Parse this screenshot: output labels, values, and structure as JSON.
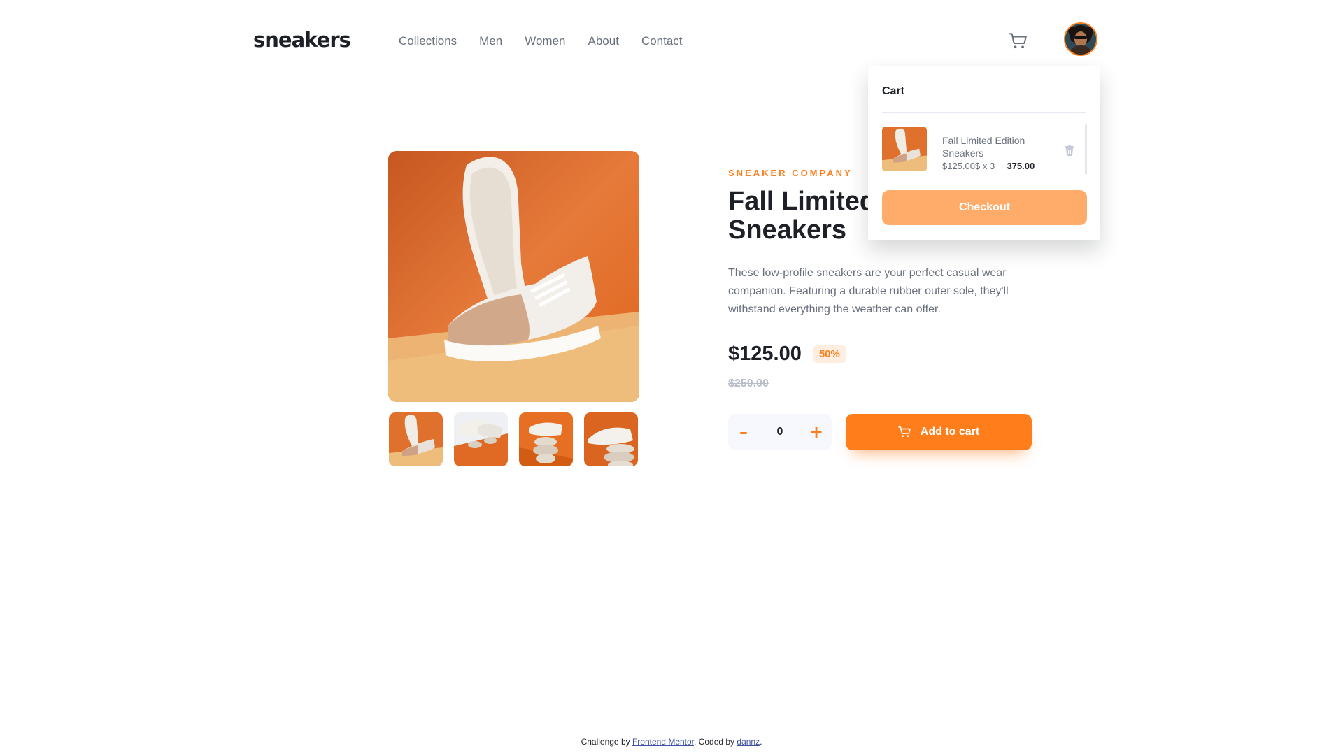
{
  "header": {
    "logo": "sneakers",
    "nav": [
      "Collections",
      "Men",
      "Women",
      "About",
      "Contact"
    ],
    "cart_icon": "cart-icon",
    "avatar_icon": "avatar"
  },
  "product": {
    "company": "SNEAKER COMPANY",
    "title": "Fall Limited Edition Sneakers",
    "description": "These low-profile sneakers are your perfect casual wear companion. Featuring a durable rubber outer sole, they'll withstand everything the weather can offer.",
    "price": "$125.00",
    "discount": "50%",
    "original_price": "$250.00",
    "quantity": "0",
    "minus_label": "–",
    "plus_label": "+",
    "add_to_cart_label": "Add to cart"
  },
  "cart": {
    "heading": "Cart",
    "item_name": "Fall Limited Edition Sneakers",
    "item_price": "$125.00$ x 3",
    "item_total": "375.00",
    "checkout_label": "Checkout"
  },
  "footer": {
    "prefix": "Challenge by ",
    "link1": "Frontend Mentor",
    "middle": ". Coded by ",
    "link2": "dannz",
    "suffix": "."
  },
  "colors": {
    "accent": "#ff7e1b",
    "accent_pale": "#ffede0",
    "checkout_disabled": "#ffab6a",
    "text_dark": "#1d2026",
    "text_gray": "#69707d"
  }
}
